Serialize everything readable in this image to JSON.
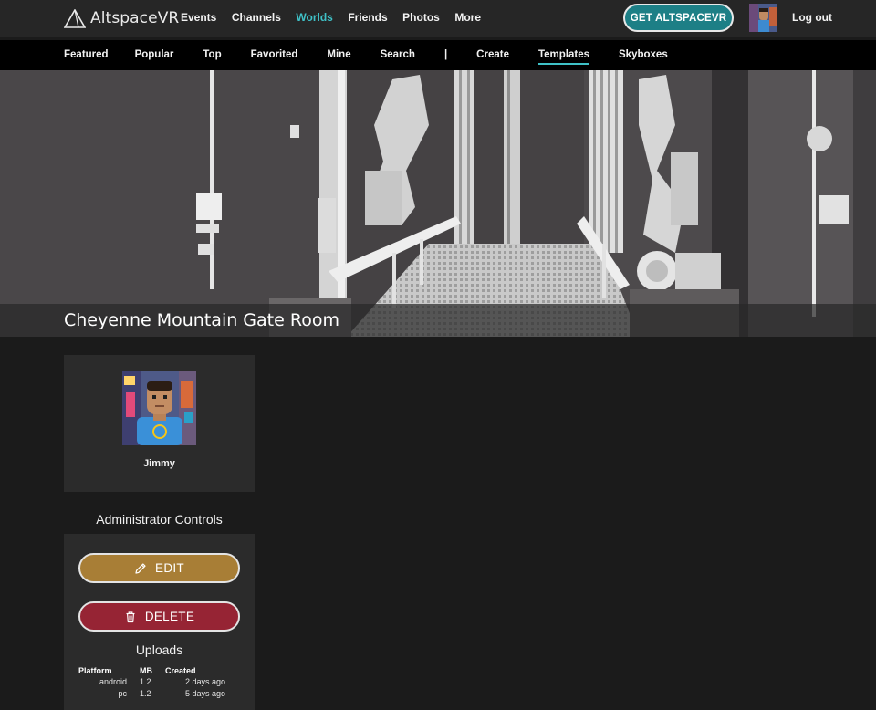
{
  "header": {
    "brand": "AltspaceVR",
    "nav": [
      {
        "label": "Events",
        "active": false
      },
      {
        "label": "Channels",
        "active": false
      },
      {
        "label": "Worlds",
        "active": true
      },
      {
        "label": "Friends",
        "active": false
      },
      {
        "label": "Photos",
        "active": false
      },
      {
        "label": "More",
        "active": false
      }
    ],
    "cta_label": "GET ALTSPACEVR",
    "logout_label": "Log out"
  },
  "subnav": {
    "items": [
      {
        "label": "Featured",
        "active": false
      },
      {
        "label": "Popular",
        "active": false
      },
      {
        "label": "Top",
        "active": false
      },
      {
        "label": "Favorited",
        "active": false
      },
      {
        "label": "Mine",
        "active": false
      },
      {
        "label": "Search",
        "active": false
      },
      {
        "label": "|",
        "active": false
      },
      {
        "label": "Create",
        "active": false
      },
      {
        "label": "Templates",
        "active": true
      },
      {
        "label": "Skyboxes",
        "active": false
      }
    ]
  },
  "world": {
    "title": "Cheyenne Mountain Gate Room"
  },
  "owner": {
    "name": "Jimmy"
  },
  "admin": {
    "title": "Administrator Controls",
    "edit_label": "EDIT",
    "delete_label": "DELETE",
    "uploads_title": "Uploads",
    "uploads_columns": [
      "Platform",
      "MB",
      "Created"
    ],
    "uploads_rows": [
      {
        "platform": "android",
        "mb": "1.2",
        "created": "2 days ago"
      },
      {
        "platform": "pc",
        "mb": "1.2",
        "created": "5 days ago"
      }
    ]
  },
  "colors": {
    "accent": "#3fc1c7",
    "cta_bg": "#1d7f86",
    "edit_bg": "#a87e36",
    "delete_bg": "#962434",
    "topbar": "#262626",
    "subbar": "#000000",
    "page_bg": "#1b1b1b",
    "card_bg": "#2b2b2b"
  }
}
